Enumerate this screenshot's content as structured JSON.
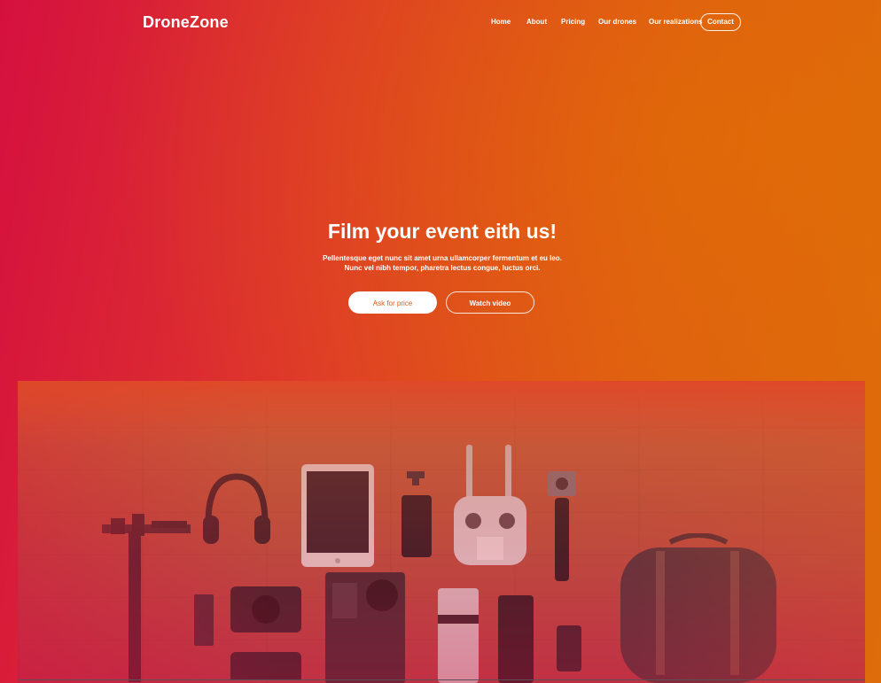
{
  "brand": {
    "logo": "DroneZone"
  },
  "nav": {
    "items": [
      "Home",
      "About",
      "Pricing",
      "Our drones",
      "Our realizations"
    ],
    "contact": "Contact"
  },
  "hero": {
    "headline": "Film your event eith us!",
    "subtext_line1": "Pellentesque eget nunc sit amet urna ullamcorper fermentum et eu leo.",
    "subtext_line2": "Nunc vel nibh tempor, pharetra lectus congue, luctus orci.",
    "primary_button": "Ask for price",
    "secondary_button": "Watch video"
  },
  "colors": {
    "gradient_left": "#d6143c",
    "gradient_right": "#dc6c08",
    "primary_button_text": "#e25a10"
  }
}
